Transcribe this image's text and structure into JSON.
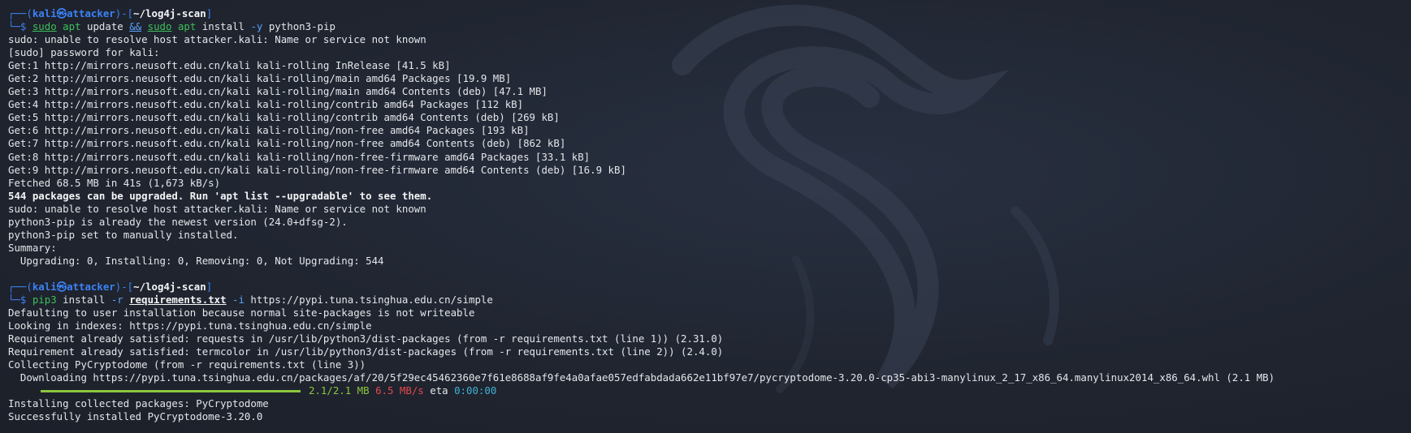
{
  "prompt": {
    "corner_top": "┌──(",
    "user": "kali",
    "at": "㉿",
    "host": "attacker",
    "mid": ")-[",
    "path": "~/log4j-scan",
    "end": "]",
    "corner_bottom": "└─$ "
  },
  "cmd1": {
    "sudo1": "sudo",
    "apt1": "apt",
    "update": " update ",
    "amp": "&&",
    "sudo2": "sudo",
    "apt2": "apt",
    "install": " install ",
    "flag": "-y",
    "pkg": " python3-pip"
  },
  "output1": [
    "sudo: unable to resolve host attacker.kali: Name or service not known",
    "[sudo] password for kali:",
    "Get:1 http://mirrors.neusoft.edu.cn/kali kali-rolling InRelease [41.5 kB]",
    "Get:2 http://mirrors.neusoft.edu.cn/kali kali-rolling/main amd64 Packages [19.9 MB]",
    "Get:3 http://mirrors.neusoft.edu.cn/kali kali-rolling/main amd64 Contents (deb) [47.1 MB]",
    "Get:4 http://mirrors.neusoft.edu.cn/kali kali-rolling/contrib amd64 Packages [112 kB]",
    "Get:5 http://mirrors.neusoft.edu.cn/kali kali-rolling/contrib amd64 Contents (deb) [269 kB]",
    "Get:6 http://mirrors.neusoft.edu.cn/kali kali-rolling/non-free amd64 Packages [193 kB]",
    "Get:7 http://mirrors.neusoft.edu.cn/kali kali-rolling/non-free amd64 Contents (deb) [862 kB]",
    "Get:8 http://mirrors.neusoft.edu.cn/kali kali-rolling/non-free-firmware amd64 Packages [33.1 kB]",
    "Get:9 http://mirrors.neusoft.edu.cn/kali kali-rolling/non-free-firmware amd64 Contents (deb) [16.9 kB]",
    "Fetched 68.5 MB in 41s (1,673 kB/s)"
  ],
  "upgrade_notice": "544 packages can be upgraded. Run 'apt list --upgradable' to see them.",
  "output2": [
    "sudo: unable to resolve host attacker.kali: Name or service not known",
    "python3-pip is already the newest version (24.0+dfsg-2).",
    "python3-pip set to manually installed.",
    "Summary:",
    "  Upgrading: 0, Installing: 0, Removing: 0, Not Upgrading: 544"
  ],
  "cmd2": {
    "pip": "pip3",
    "install": " install ",
    "flag_r": "-r",
    "req_file": "requirements.txt",
    "flag_i": "-i",
    "url": " https://pypi.tuna.tsinghua.edu.cn/simple"
  },
  "output3": [
    "Defaulting to user installation because normal site-packages is not writeable",
    "Looking in indexes: https://pypi.tuna.tsinghua.edu.cn/simple",
    "Requirement already satisfied: requests in /usr/lib/python3/dist-packages (from -r requirements.txt (line 1)) (2.31.0)",
    "Requirement already satisfied: termcolor in /usr/lib/python3/dist-packages (from -r requirements.txt (line 2)) (2.4.0)",
    "Collecting PyCryptodome (from -r requirements.txt (line 3))",
    "  Downloading https://pypi.tuna.tsinghua.edu.cn/packages/af/20/5f29ec45462360e7f61e8688af9fe4a0afae057edfabdada662e11bf97e7/pycryptodome-3.20.0-cp35-abi3-manylinux_2_17_x86_64.manylinux2014_x86_64.whl (2.1 MB)"
  ],
  "progress": {
    "fraction": 1.0,
    "size": "2.1/2.1 MB",
    "speed": "6.5 MB/s",
    "eta_label": "eta",
    "eta": "0:00:00"
  },
  "output4": [
    "Installing collected packages: PyCryptodome",
    "Successfully installed PyCryptodome-3.20.0"
  ],
  "colors": {
    "background": "#212630",
    "prompt_blue": "#3b82f6",
    "command_green": "#3fbf5a",
    "progress_green": "#8cc63f",
    "speed_red": "#e5484d",
    "eta_cyan": "#3fb3d6"
  }
}
